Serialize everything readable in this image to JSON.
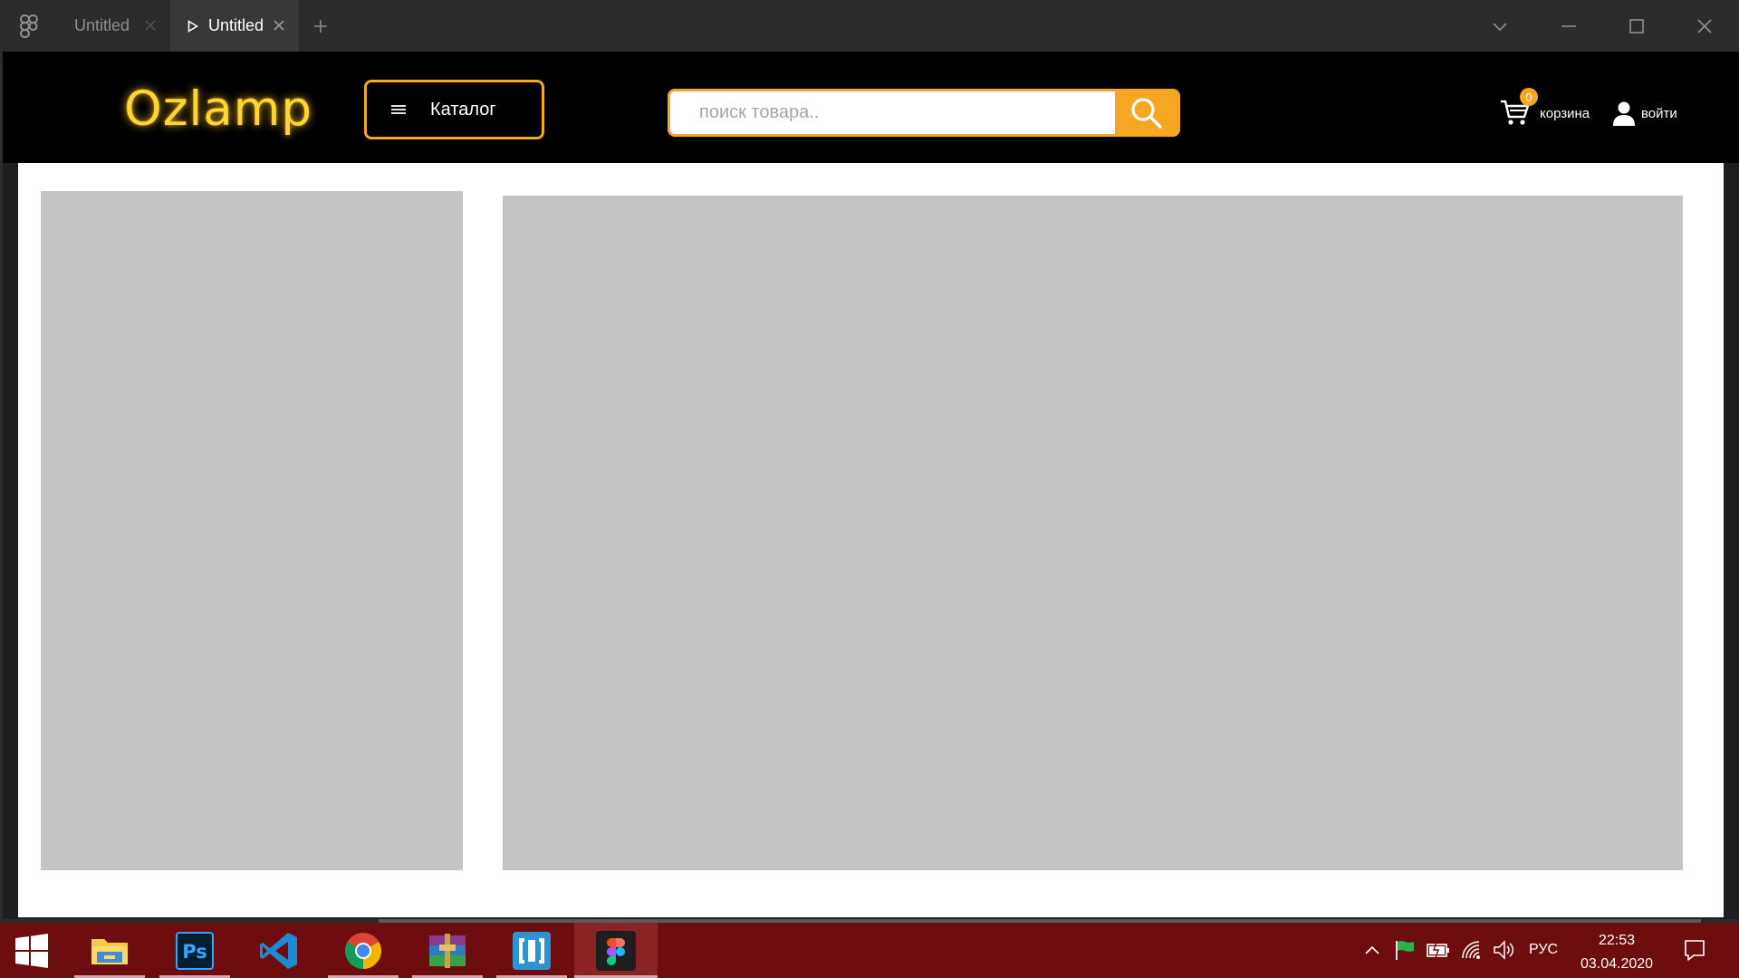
{
  "titlebar": {
    "tabs": [
      {
        "label": "Untitled",
        "active": false
      },
      {
        "label": "Untitled",
        "active": true
      }
    ]
  },
  "site": {
    "logo": "Ozlamp",
    "catalog_label": "Каталог",
    "search_placeholder": "поиск товара..",
    "cart_count": "0",
    "cart_label": "корзина",
    "login_label": "войти"
  },
  "colors": {
    "accent": "#f5a623",
    "logo": "#ffd633",
    "header_bg": "#000000",
    "placeholder_block": "#c4c4c4",
    "taskbar": "#6e0d10"
  },
  "taskbar": {
    "apps": [
      "file-explorer",
      "photoshop",
      "vs-code",
      "chrome",
      "winrar",
      "brackets",
      "figma"
    ],
    "language": "РУС",
    "time": "22:53",
    "date": "03.04.2020"
  }
}
